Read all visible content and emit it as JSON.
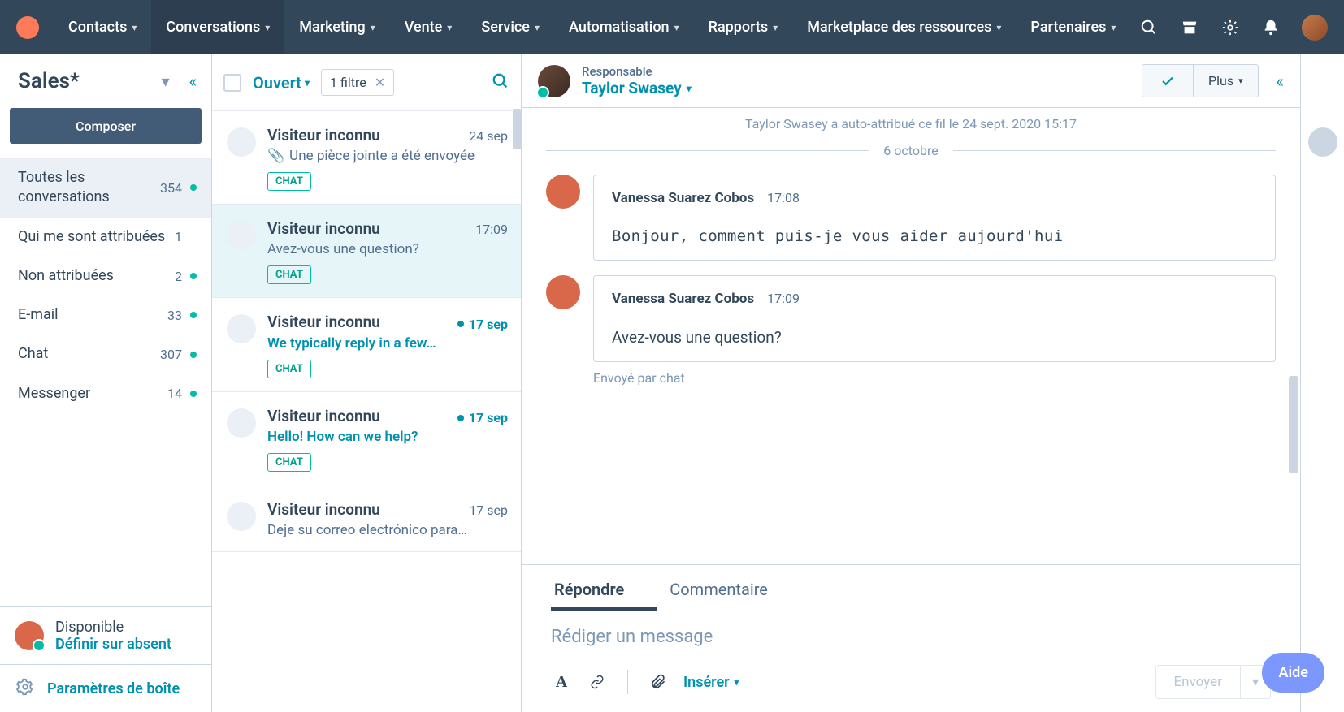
{
  "nav": {
    "items": [
      "Contacts",
      "Conversations",
      "Marketing",
      "Vente",
      "Service",
      "Automatisation",
      "Rapports",
      "Marketplace des ressources",
      "Partenaires"
    ],
    "active_index": 1
  },
  "sidebar": {
    "inbox_name": "Sales*",
    "compose_label": "Composer",
    "views": [
      {
        "label": "Toutes les conversations",
        "count": "354",
        "dot": true,
        "selected": true
      },
      {
        "label": "Qui me sont attribuées",
        "count": "1",
        "dot": false
      },
      {
        "label": "Non attribuées",
        "count": "2",
        "dot": true
      },
      {
        "label": "E-mail",
        "count": "33",
        "dot": true
      },
      {
        "label": "Chat",
        "count": "307",
        "dot": true
      },
      {
        "label": "Messenger",
        "count": "14",
        "dot": true
      }
    ],
    "status_available": "Disponible",
    "status_set_away": "Définir sur absent",
    "settings_link": "Paramètres de boîte"
  },
  "list": {
    "open_label": "Ouvert",
    "filter_pill": "1 filtre",
    "threads": [
      {
        "name": "Visiteur inconnu",
        "date": "24 sep",
        "snippet": "Une pièce jointe a été envoyée",
        "tag": "CHAT",
        "attachment": true,
        "unread": false,
        "link": false,
        "selected": false
      },
      {
        "name": "Visiteur inconnu",
        "date": "17:09",
        "snippet": "Avez-vous une question?",
        "tag": "CHAT",
        "attachment": false,
        "unread": false,
        "link": false,
        "selected": true
      },
      {
        "name": "Visiteur inconnu",
        "date": "17 sep",
        "snippet": "We typically reply in a few…",
        "tag": "CHAT",
        "attachment": false,
        "unread": true,
        "link": true,
        "selected": false
      },
      {
        "name": "Visiteur inconnu",
        "date": "17 sep",
        "snippet": "Hello! How can we help?",
        "tag": "CHAT",
        "attachment": false,
        "unread": true,
        "link": true,
        "selected": false
      },
      {
        "name": "Visiteur inconnu",
        "date": "17 sep",
        "snippet": "Deje su correo electrónico para…",
        "tag": "",
        "attachment": false,
        "unread": false,
        "link": false,
        "selected": false
      }
    ]
  },
  "thread": {
    "owner_label": "Responsable",
    "owner_name": "Taylor Swasey",
    "more_label": "Plus",
    "system_line": "Taylor Swasey a auto-attribué ce fil le 24 sept. 2020 15:17",
    "date_separator": "6 octobre",
    "messages": [
      {
        "author": "Vanessa Suarez Cobos",
        "time": "17:08",
        "body": "Bonjour, comment puis-je vous aider aujourd'hui",
        "mono": true
      },
      {
        "author": "Vanessa Suarez Cobos",
        "time": "17:09",
        "body": "Avez-vous une question?",
        "mono": false
      }
    ],
    "sent_via": "Envoyé par chat"
  },
  "composer": {
    "tab_reply": "Répondre",
    "tab_comment": "Commentaire",
    "placeholder": "Rédiger un message",
    "insert_label": "Insérer",
    "send_label": "Envoyer"
  },
  "help_label": "Aide"
}
